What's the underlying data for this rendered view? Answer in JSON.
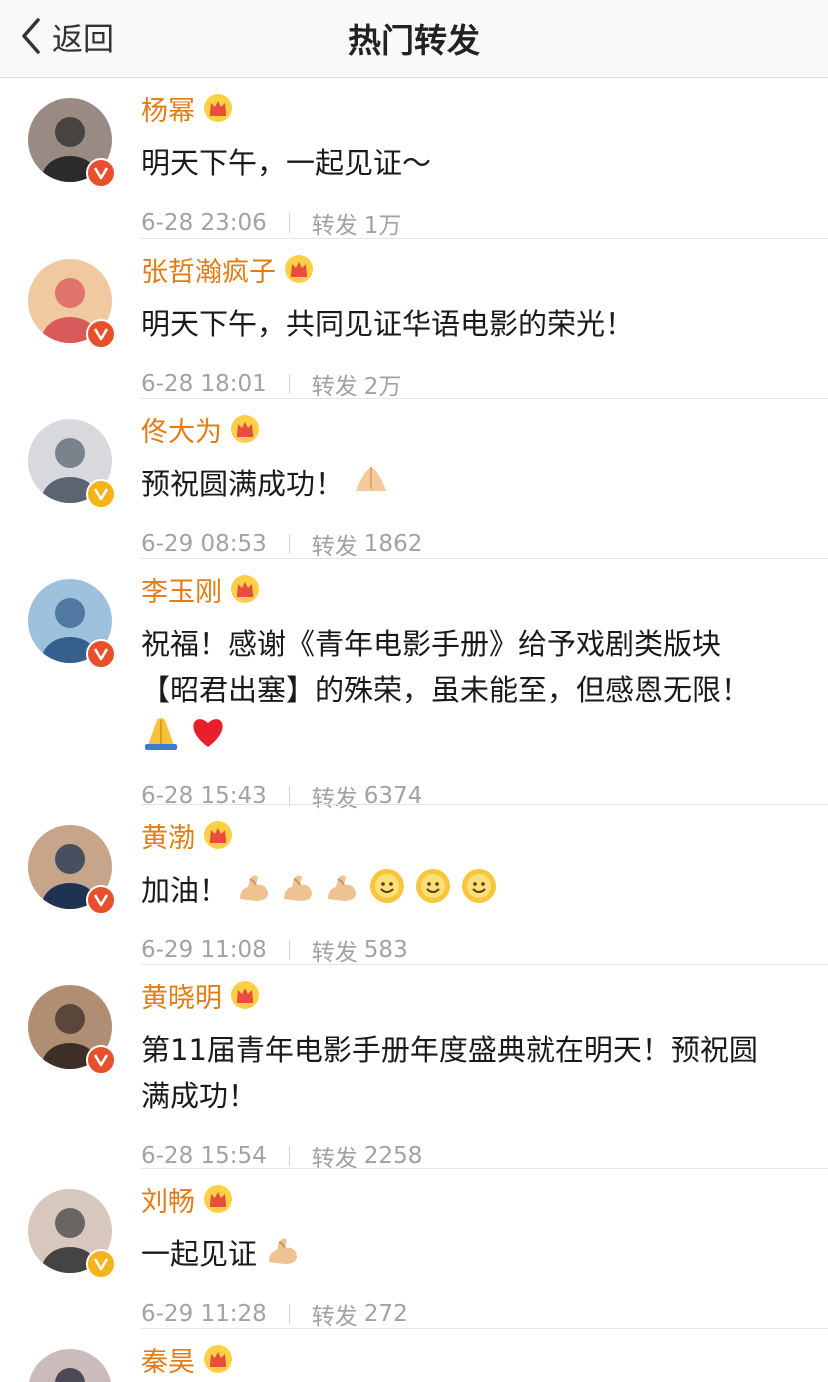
{
  "header": {
    "back_label": "返回",
    "title": "热门转发"
  },
  "repost_label": "转发",
  "posts": [
    {
      "name": "杨幂",
      "text": [
        "明天下午，一起见证～"
      ],
      "emojis": [],
      "time": "6-28 23:06",
      "reposts": "1万",
      "verified": "red"
    },
    {
      "name": "张哲瀚疯子",
      "text": [
        "明天下午，共同见证华语电影的荣光！"
      ],
      "emojis": [],
      "time": "6-28 18:01",
      "reposts": "2万",
      "verified": "red"
    },
    {
      "name": "佟大为",
      "text": [
        "预祝圆满成功！"
      ],
      "emojis": [
        "ok-hand-icon"
      ],
      "time": "6-29 08:53",
      "reposts": "1862",
      "verified": "gold"
    },
    {
      "name": "李玉刚",
      "text": [
        "祝福！感谢《青年电影手册》给予戏剧类版块",
        "【昭君出塞】的殊荣，虽未能至，但感恩无限！"
      ],
      "emojis": [
        "pray-icon",
        "heart-icon"
      ],
      "time": "6-28 15:43",
      "reposts": "6374",
      "verified": "red"
    },
    {
      "name": "黄渤",
      "text": [
        "加油！"
      ],
      "emojis": [
        "muscle-icon",
        "muscle-icon",
        "muscle-icon",
        "sun-smile-icon",
        "sun-smile-icon",
        "sun-smile-icon"
      ],
      "time": "6-29 11:08",
      "reposts": "583",
      "verified": "red"
    },
    {
      "name": "黄晓明",
      "text": [
        "第11届青年电影手册年度盛典就在明天！预祝圆",
        "满成功！"
      ],
      "emojis": [],
      "time": "6-28 15:54",
      "reposts": "2258",
      "verified": "red"
    },
    {
      "name": "刘畅",
      "text": [
        "一起见证"
      ],
      "emojis": [
        "muscle-icon"
      ],
      "time": "6-29 11:28",
      "reposts": "272",
      "verified": "gold"
    },
    {
      "name": "秦昊",
      "text": [],
      "emojis": [],
      "time": "",
      "reposts": "",
      "verified": "red"
    }
  ],
  "colors": {
    "name": "#e57b13",
    "meta": "#a2a2a2",
    "badge_red": "#e8502d",
    "badge_gold": "#f3b319"
  }
}
